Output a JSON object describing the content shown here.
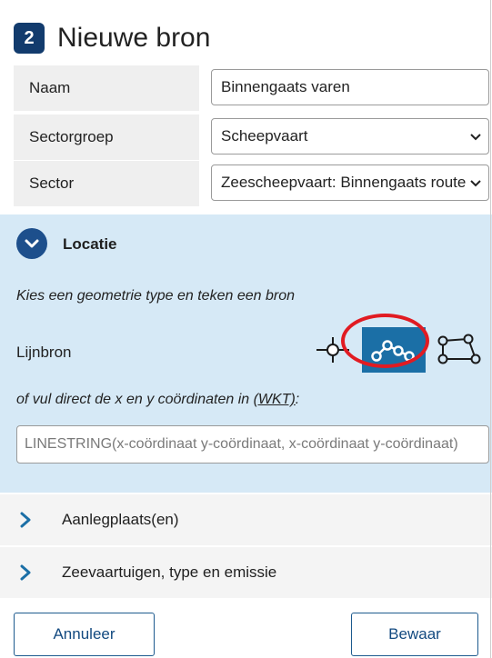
{
  "header": {
    "step": "2",
    "title": "Nieuwe bron"
  },
  "form": {
    "name": {
      "label": "Naam",
      "value": "Binnengaats varen"
    },
    "sector_group": {
      "label": "Sectorgroep",
      "value": "Scheepvaart"
    },
    "sector": {
      "label": "Sector",
      "value": "Zeescheepvaart: Binnengaats route"
    }
  },
  "location": {
    "title": "Locatie",
    "hint": "Kies een geometrie type en teken een bron",
    "geometry_label": "Lijnbron",
    "geometry_options": [
      "point-icon",
      "line-icon",
      "polygon-icon"
    ],
    "selected_geometry": "line-icon",
    "wkt_prefix": "of vul direct de x en y coördinaten in ",
    "wkt_link": "(WKT)",
    "wkt_suffix": ":",
    "wkt_placeholder": "LINESTRING(x-coördinaat y-coördinaat, x-coördinaat y-coördinaat)"
  },
  "sections": [
    {
      "label": "Aanlegplaats(en)"
    },
    {
      "label": "Zeevaartuigen, type en emissie"
    }
  ],
  "footer": {
    "cancel_label": "Annuleer",
    "save_label": "Bewaar"
  },
  "colors": {
    "accent": "#1b6fa6",
    "badge": "#123b6d",
    "highlight": "#e11b22",
    "section_bg": "#d6e9f6"
  }
}
